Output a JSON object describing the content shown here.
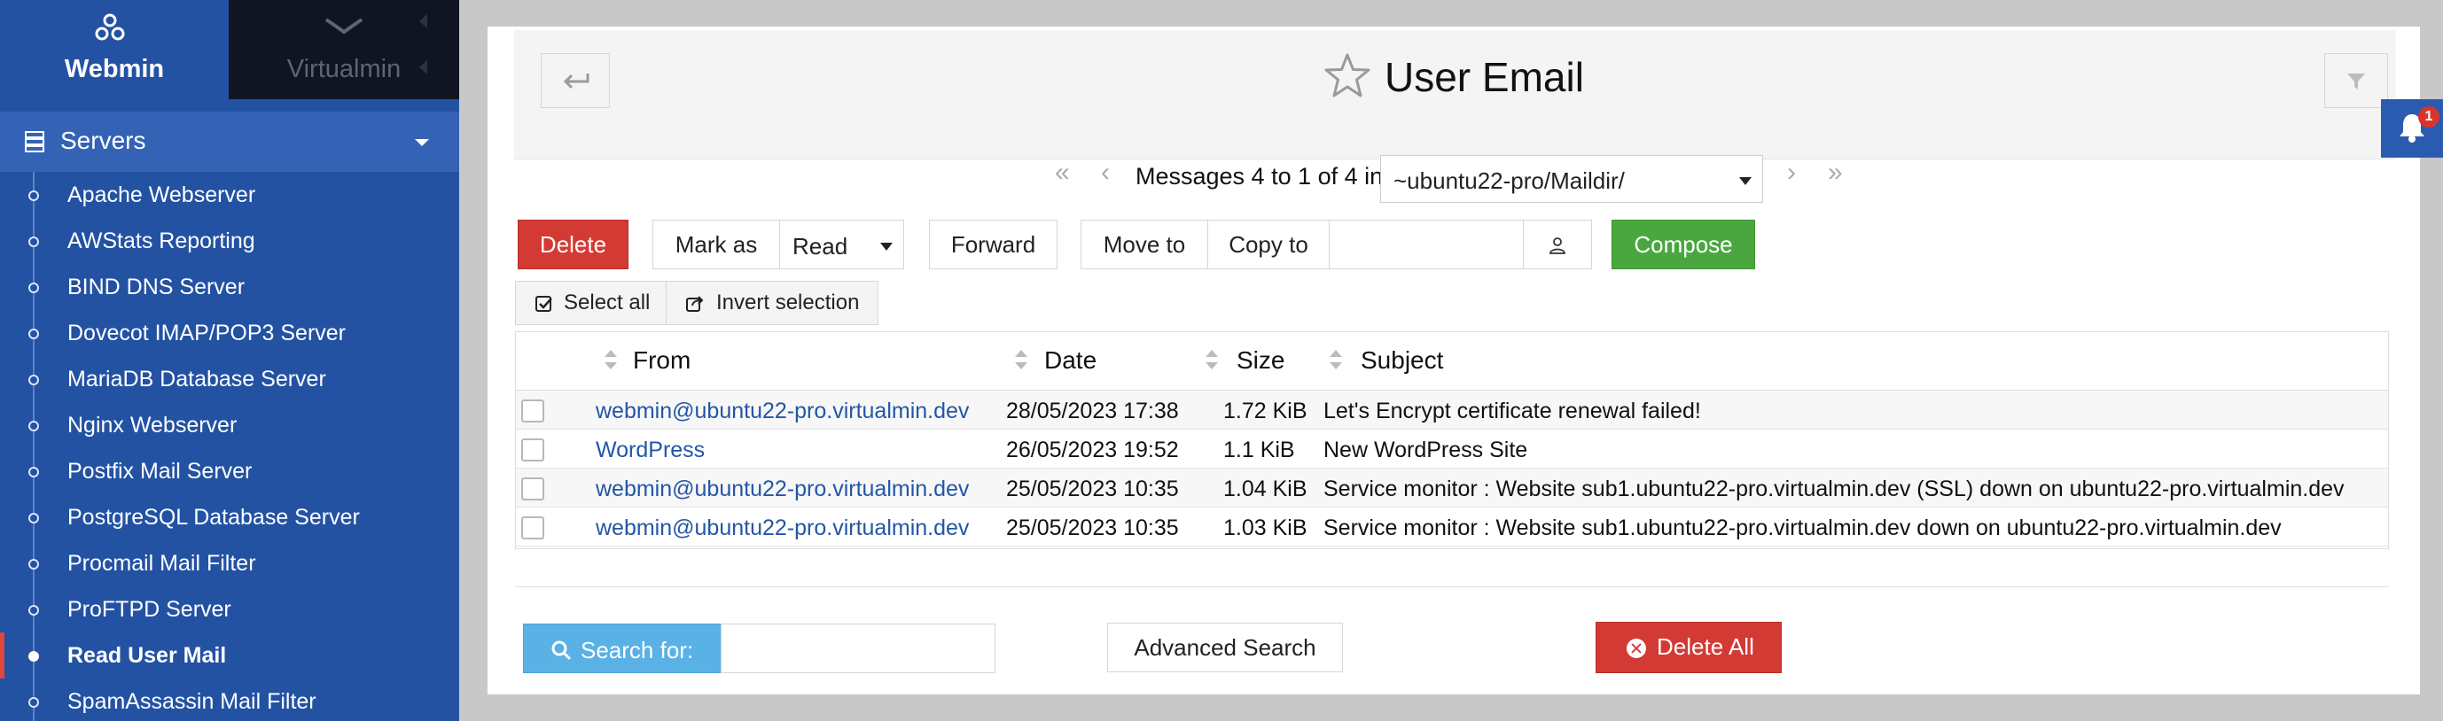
{
  "sidebar": {
    "tabs": {
      "webmin": "Webmin",
      "virtualmin": "Virtualmin"
    },
    "section": "Servers",
    "items": [
      {
        "label": "Apache Webserver"
      },
      {
        "label": "AWStats Reporting"
      },
      {
        "label": "BIND DNS Server"
      },
      {
        "label": "Dovecot IMAP/POP3 Server"
      },
      {
        "label": "MariaDB Database Server"
      },
      {
        "label": "Nginx Webserver"
      },
      {
        "label": "Postfix Mail Server"
      },
      {
        "label": "PostgreSQL Database Server"
      },
      {
        "label": "Procmail Mail Filter"
      },
      {
        "label": "ProFTPD Server"
      },
      {
        "label": "Read User Mail",
        "active": true
      },
      {
        "label": "SpamAssassin Mail Filter"
      }
    ]
  },
  "page": {
    "title": "User Email"
  },
  "notifications": {
    "count": "1"
  },
  "pager": {
    "text": "Messages 4 to 1 of 4 in",
    "folder": "~ubuntu22-pro/Maildir/"
  },
  "toolbar": {
    "delete": "Delete",
    "mark_as": "Mark as",
    "mark_value": "Read",
    "forward": "Forward",
    "move_to": "Move to",
    "copy_to": "Copy to",
    "compose": "Compose",
    "select_all": "Select all",
    "invert_selection": "Invert selection"
  },
  "table": {
    "headers": {
      "from": "From",
      "date": "Date",
      "size": "Size",
      "subject": "Subject"
    },
    "rows": [
      {
        "from": "webmin@ubuntu22-pro.virtualmin.dev",
        "date": "28/05/2023 17:38",
        "size": "1.72 KiB",
        "subject": "Let's Encrypt certificate renewal failed!"
      },
      {
        "from": "WordPress",
        "date": "26/05/2023 19:52",
        "size": "1.1 KiB",
        "subject": "New WordPress Site"
      },
      {
        "from": "webmin@ubuntu22-pro.virtualmin.dev",
        "date": "25/05/2023 10:35",
        "size": "1.04 KiB",
        "subject": "Service monitor : Website sub1.ubuntu22-pro.virtualmin.dev (SSL) down on ubuntu22-pro.virtualmin.dev"
      },
      {
        "from": "webmin@ubuntu22-pro.virtualmin.dev",
        "date": "25/05/2023 10:35",
        "size": "1.03 KiB",
        "subject": "Service monitor : Website sub1.ubuntu22-pro.virtualmin.dev down on ubuntu22-pro.virtualmin.dev"
      }
    ]
  },
  "footer": {
    "search_for": "Search for:",
    "advanced_search": "Advanced Search",
    "delete_all": "Delete All"
  },
  "colors": {
    "sidebar_bg": "#2352a3",
    "delete_red": "#d23a33",
    "compose_green": "#4aa73f",
    "search_blue": "#5ab1e5",
    "link_blue": "#2456a6"
  }
}
